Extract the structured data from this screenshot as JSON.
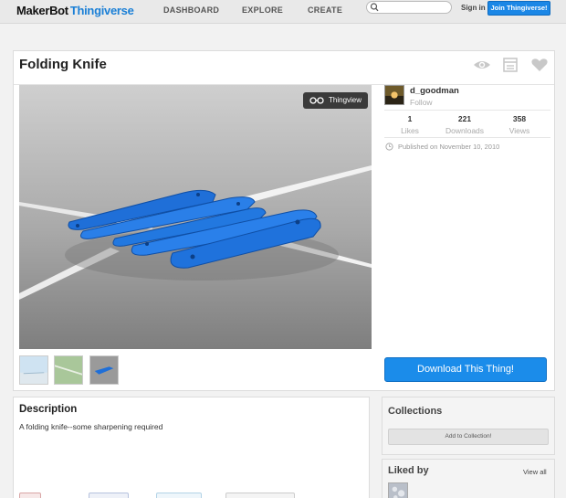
{
  "header": {
    "logo_left": "MakerBot",
    "logo_right": "Thingiverse",
    "nav": [
      "DASHBOARD",
      "EXPLORE",
      "CREATE"
    ],
    "search_placeholder": "",
    "signin": "Sign in",
    "join": "Join Thingiverse!"
  },
  "thing": {
    "title": "Folding Knife",
    "thingview_label": "Thingview",
    "owner": "d_goodman",
    "follow": "Follow",
    "stats": [
      {
        "value": "1",
        "label": "Likes"
      },
      {
        "value": "221",
        "label": "Downloads"
      },
      {
        "value": "358",
        "label": "Views"
      }
    ],
    "published": "Published on November 10, 2010",
    "download_label": "Download This Thing!"
  },
  "description": {
    "title": "Description",
    "text": "A folding knife--some sharpening required"
  },
  "collections": {
    "title": "Collections",
    "add_label": "Add to Collection!"
  },
  "liked_by": {
    "title": "Liked by",
    "view_all": "View all"
  },
  "colors": {
    "accent": "#1b8cea",
    "brand_blue": "#1a7fd6",
    "model_blue": "#1f6fd8"
  }
}
